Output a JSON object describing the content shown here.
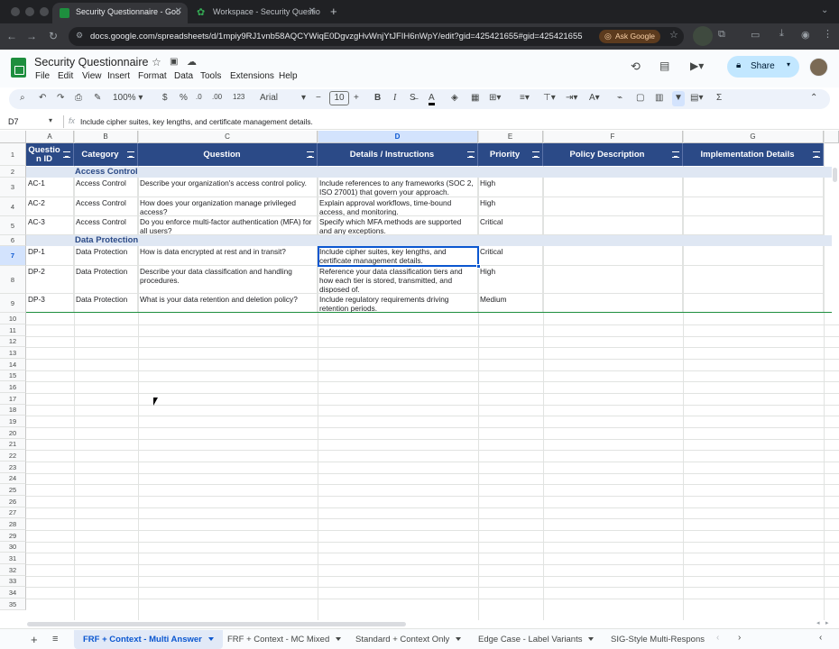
{
  "browser": {
    "tabs": [
      {
        "title": "Security Questionnaire - Goo",
        "active": true
      },
      {
        "title": "Workspace - Security Questio",
        "active": false
      }
    ],
    "new_tab": "+",
    "url": "docs.google.com/spreadsheets/d/1mpiy9RJ1vnb58AQCYWiqE0DgvzgHvWnjYtJFIH6nWpY/edit?gid=425421655#gid=425421655",
    "ask_google": "Ask Google"
  },
  "doc": {
    "title": "Security Questionnaire",
    "menus": [
      "File",
      "Edit",
      "View",
      "Insert",
      "Format",
      "Data",
      "Tools",
      "Extensions",
      "Help"
    ],
    "share_label": "Share"
  },
  "toolbar": {
    "zoom": "100%",
    "currency": "$",
    "percent": "%",
    "decimal_less": ".0",
    "decimal_more": ".00",
    "number_format": "123",
    "font": "Arial",
    "font_size": "10",
    "bold": "B",
    "italic": "I"
  },
  "formula_bar": {
    "cell_ref": "D7",
    "fx": "fx",
    "content": "Include cipher suites, key lengths, and certificate management details."
  },
  "columns": [
    {
      "letter": "A",
      "header": "Questio n ID"
    },
    {
      "letter": "B",
      "header": "Category"
    },
    {
      "letter": "C",
      "header": "Question"
    },
    {
      "letter": "D",
      "header": "Details / Instructions"
    },
    {
      "letter": "E",
      "header": "Priority"
    },
    {
      "letter": "F",
      "header": "Policy Description"
    },
    {
      "letter": "G",
      "header": "Implementation Details"
    }
  ],
  "row_numbers": [
    "1",
    "2",
    "3",
    "4",
    "5",
    "6",
    "7",
    "8",
    "9",
    "10",
    "11",
    "12",
    "13",
    "14",
    "15",
    "16",
    "17",
    "18",
    "19",
    "20",
    "21",
    "22",
    "23",
    "24",
    "25",
    "26",
    "27",
    "28",
    "29",
    "30",
    "31",
    "32",
    "33",
    "34",
    "35"
  ],
  "sections": {
    "access": "Access Control",
    "data": "Data Protection"
  },
  "rows": [
    {
      "id": "AC-1",
      "category": "Access Control",
      "question": "Describe your organization's access control policy.",
      "details": "Include references to any frameworks (SOC 2, ISO 27001) that govern your approach.",
      "priority": "High"
    },
    {
      "id": "AC-2",
      "category": "Access Control",
      "question": "How does your organization manage privileged access?",
      "details": "Explain approval workflows, time-bound access, and monitoring.",
      "priority": "High"
    },
    {
      "id": "AC-3",
      "category": "Access Control",
      "question": "Do you enforce multi-factor authentication (MFA) for all users?",
      "details": "Specify which MFA methods are supported and any exceptions.",
      "priority": "Critical"
    },
    {
      "id": "DP-1",
      "category": "Data Protection",
      "question": "How is data encrypted at rest and in transit?",
      "details": "Include cipher suites, key lengths, and certificate management details.",
      "priority": "Critical"
    },
    {
      "id": "DP-2",
      "category": "Data Protection",
      "question": "Describe your data classification and handling procedures.",
      "details": "Reference your data classification tiers and how each tier is stored, transmitted, and disposed of.",
      "priority": "High"
    },
    {
      "id": "DP-3",
      "category": "Data Protection",
      "question": "What is your data retention and deletion policy?",
      "details": "Include regulatory requirements driving retention periods.",
      "priority": "Medium"
    }
  ],
  "sheet_tabs": [
    {
      "label": "FRF + Context - Multi Answer",
      "active": true
    },
    {
      "label": "FRF + Context - MC Mixed",
      "active": false
    },
    {
      "label": "Standard + Context Only",
      "active": false
    },
    {
      "label": "Edge Case - Label Variants",
      "active": false
    },
    {
      "label": "SIG-Style Multi-Respons",
      "active": false
    }
  ],
  "colors": {
    "header_bg": "#2b4a87",
    "section_bg": "#dfe7f3",
    "selection": "#0b57d0",
    "share_bg": "#c2e7ff"
  }
}
